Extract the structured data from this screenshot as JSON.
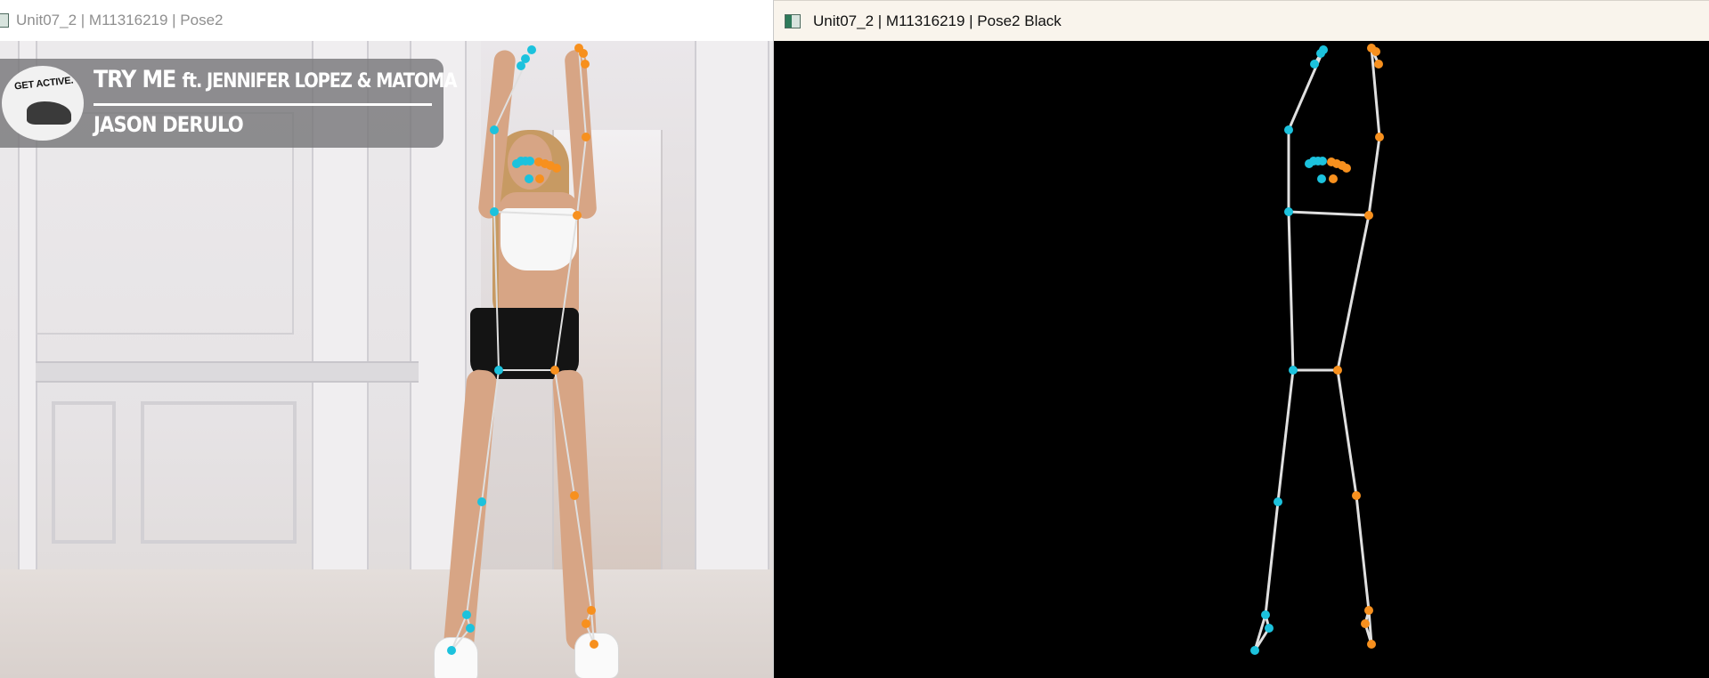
{
  "windows": [
    {
      "title": "Unit07_2 | M11316219 | Pose2",
      "icon": "app-window-icon"
    },
    {
      "title": "Unit07_2 | M11316219 | Pose2 Black",
      "icon": "app-window-icon"
    }
  ],
  "video_overlay": {
    "logo_text": "GET ACTIVE.",
    "song_title": "TRY ME",
    "song_feat": "ft. JENNIFER LOPEZ & MATOMA",
    "artist": "JASON DERULO"
  },
  "colors": {
    "left_keypoint": "#1cc2dd",
    "right_keypoint": "#f7901e",
    "skeleton_line": "#e0e0e0",
    "black_background": "#000000"
  }
}
